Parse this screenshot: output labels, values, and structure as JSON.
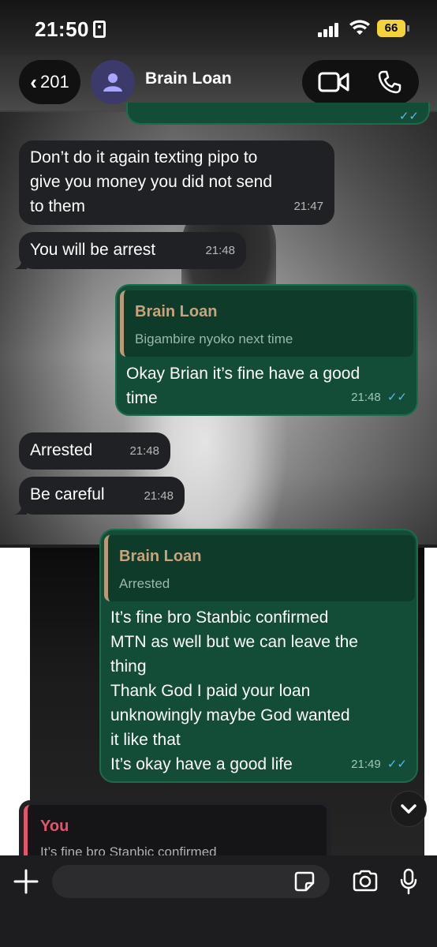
{
  "status_bar": {
    "time": "21:50",
    "battery": "66"
  },
  "header": {
    "back_count": "201",
    "contact_name": "Brain Loan"
  },
  "messages": [
    {
      "direction": "in",
      "lines": [
        "Don’t do it again texting pipo to",
        "give you money you did not send",
        "to them"
      ],
      "time": "21:47"
    },
    {
      "direction": "in",
      "lines": [
        "You will be arrest"
      ],
      "time": "21:48"
    },
    {
      "direction": "out",
      "reply_to": {
        "name": "Brain Loan",
        "text": "Bigambire nyoko next time"
      },
      "lines": [
        "Okay Brian it’s fine have a good",
        "time"
      ],
      "time": "21:48",
      "ticks": "✓✓"
    },
    {
      "direction": "in",
      "lines": [
        "Arrested"
      ],
      "time": "21:48"
    },
    {
      "direction": "in",
      "lines": [
        "Be careful"
      ],
      "time": "21:48"
    },
    {
      "direction": "out",
      "reply_to": {
        "name": "Brain Loan",
        "text": "Arrested"
      },
      "lines": [
        "It’s fine bro Stanbic confirmed",
        "MTN as well but we can leave the",
        "thing",
        "Thank God I paid your loan",
        "unknowingly maybe God wanted",
        "it like that",
        "It’s okay have a good life"
      ],
      "time": "21:49",
      "ticks": "✓✓"
    }
  ],
  "partial_quote": {
    "name": "You",
    "text": "It’s fine bro Stanbic confirmed"
  },
  "icons": {
    "back": "chevron-left-icon",
    "avatar": "person-icon",
    "video": "video-camera-icon",
    "call": "phone-icon",
    "scroll": "chevron-down-icon",
    "attach": "plus-icon",
    "sticker": "sticker-icon",
    "camera": "camera-icon",
    "mic": "microphone-icon"
  },
  "colors": {
    "incoming_bubble": "#1f2124",
    "outgoing_bubble": "#144d37",
    "reply_name": "#c9a37e",
    "you_name": "#e0566b",
    "read_ticks": "#53bdeb",
    "battery": "#f2d33b"
  }
}
